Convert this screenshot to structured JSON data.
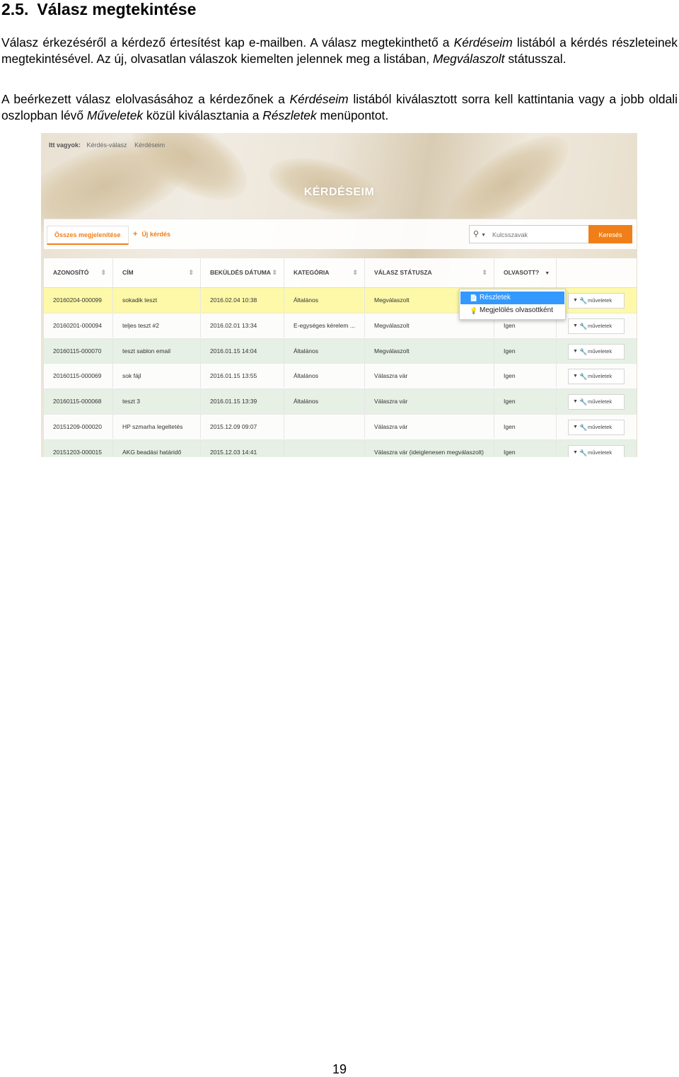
{
  "doc": {
    "section_number": "2.5.",
    "section_title": "Válasz megtekintése",
    "p1": {
      "t1": "Válasz érkezéséről a kérdező értesítést kap e-mailben. A válasz megtekinthető a ",
      "i1": "Kérdéseim",
      "t2": " listából a kérdés részleteinek megtekintésével. Az új, olvasatlan válaszok kiemelten jelennek meg a listában, ",
      "i2": "Megválaszolt",
      "t3": " státusszal."
    },
    "p2": {
      "t1": "A beérkezett válasz elolvasásához a kérdezőnek a ",
      "i1": "Kérdéseim",
      "t2": " listából kiválasztott sorra kell kattintania vagy a jobb oldali oszlopban lévő ",
      "i2": "Műveletek",
      "t3": " közül kiválasztania a ",
      "i3": "Részletek",
      "t4": " menüpontot."
    },
    "page_number": "19"
  },
  "screenshot": {
    "breadcrumb": {
      "label": "Itt vagyok:",
      "items": [
        "Kérdés-válasz",
        "Kérdéseim"
      ]
    },
    "title": "KÉRDÉSEIM",
    "toolbar": {
      "show_all": "Összes megjelenítése",
      "new_question": "Új kérdés",
      "search_placeholder": "Kulcsszavak",
      "search_button": "Keresés"
    },
    "columns": [
      "AZONOSÍTÓ",
      "CÍM",
      "BEKÜLDÉS DÁTUMA",
      "KATEGÓRIA",
      "VÁLASZ STÁTUSZA",
      "OLVASOTT?"
    ],
    "rows": [
      {
        "id": "20160204-000099",
        "title": "sokadik teszt",
        "date": "2016.02.04 10:38",
        "category": "Általános",
        "status": "Megválaszolt",
        "read": "",
        "ops": "műveletek"
      },
      {
        "id": "20160201-000094",
        "title": "teljes teszt #2",
        "date": "2016.02.01 13:34",
        "category": "E-egységes kérelem ...",
        "status": "Megválaszolt",
        "read": "Igen",
        "ops": "műveletek"
      },
      {
        "id": "20160115-000070",
        "title": "teszt sablon email",
        "date": "2016.01.15 14:04",
        "category": "Általános",
        "status": "Megválaszolt",
        "read": "Igen",
        "ops": "műveletek"
      },
      {
        "id": "20160115-000069",
        "title": "sok fájl",
        "date": "2016.01.15 13:55",
        "category": "Általános",
        "status": "Válaszra vár",
        "read": "Igen",
        "ops": "műveletek"
      },
      {
        "id": "20160115-000068",
        "title": "teszt 3",
        "date": "2016.01.15 13:39",
        "category": "Általános",
        "status": "Válaszra vár",
        "read": "Igen",
        "ops": "műveletek"
      },
      {
        "id": "20151209-000020",
        "title": "HP szmarha legeltetés",
        "date": "2015.12.09 09:07",
        "category": "",
        "status": "Válaszra vár",
        "read": "Igen",
        "ops": "műveletek"
      },
      {
        "id": "20151203-000015",
        "title": "AKG beadási határidő",
        "date": "2015.12.03 14:41",
        "category": "",
        "status": "Válaszra vár (ideiglenesen megválaszolt)",
        "read": "Igen",
        "ops": "műveletek"
      }
    ],
    "dropdown": {
      "details": "Részletek",
      "mark_read": "Megjelölés olvasottként"
    },
    "colors": {
      "accent": "#f07f19",
      "highlight_row": "#fdf9a8",
      "green_row": "#e6f0e4",
      "dropdown_selected": "#3399ff"
    }
  }
}
